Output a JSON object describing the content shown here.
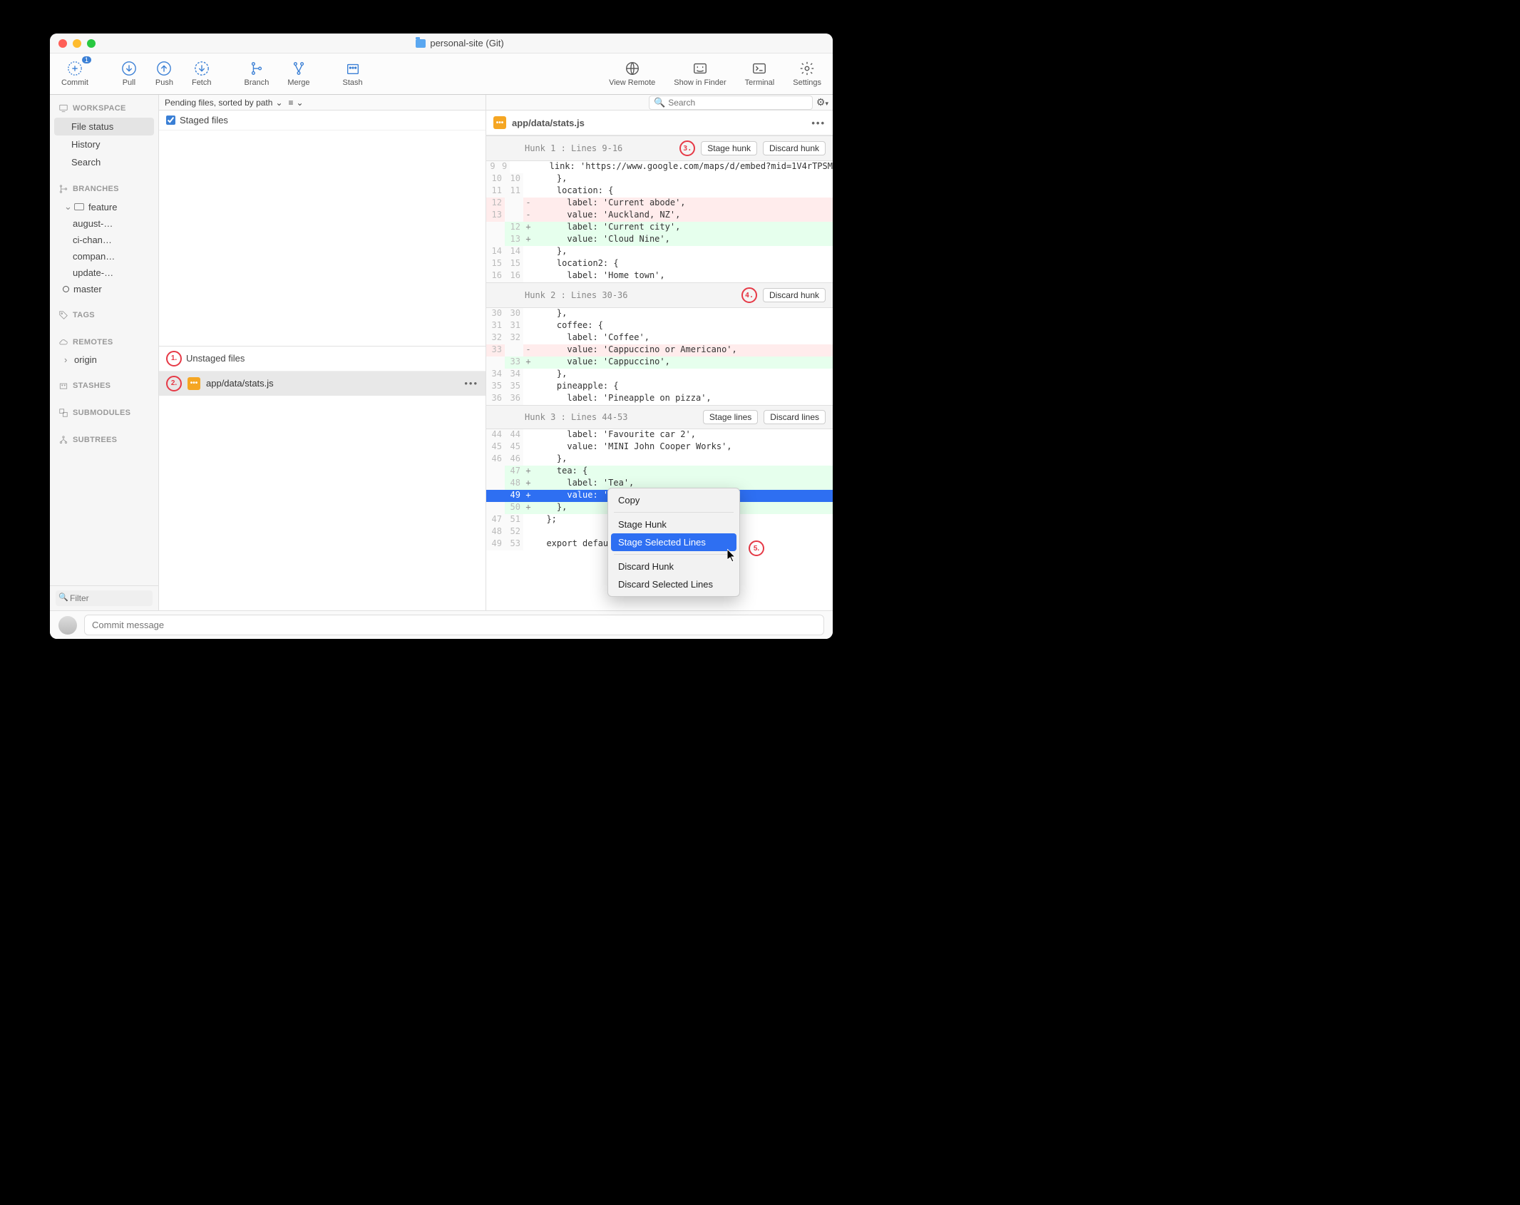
{
  "window": {
    "title": "personal-site (Git)"
  },
  "toolbar": {
    "commit": "Commit",
    "commit_badge": "1",
    "pull": "Pull",
    "push": "Push",
    "fetch": "Fetch",
    "branch": "Branch",
    "merge": "Merge",
    "stash": "Stash",
    "view_remote": "View Remote",
    "show_in_finder": "Show in Finder",
    "terminal": "Terminal",
    "settings": "Settings"
  },
  "sidebar": {
    "workspace": "WORKSPACE",
    "file_status": "File status",
    "history": "History",
    "search": "Search",
    "branches": "BRANCHES",
    "feature_folder": "feature",
    "branch_items": [
      "august-…",
      "ci-chan…",
      "compan…",
      "update-…"
    ],
    "master": "master",
    "tags": "TAGS",
    "remotes": "REMOTES",
    "origin": "origin",
    "stashes": "STASHES",
    "submodules": "SUBMODULES",
    "subtrees": "SUBTREES",
    "filter_placeholder": "Filter"
  },
  "middle": {
    "sort_label": "Pending files, sorted by path",
    "staged_label": "Staged files",
    "unstaged_label": "Unstaged files",
    "file_path": "app/data/stats.js",
    "search_placeholder": "Search"
  },
  "right": {
    "file_path": "app/data/stats.js",
    "hunk1": {
      "title": "Hunk 1 : Lines 9-16",
      "stage": "Stage hunk",
      "discard": "Discard hunk",
      "lines": [
        {
          "oldN": "9",
          "newN": "9",
          "mark": "",
          "text": "      link: 'https://www.google.com/maps/d/embed?mid=1V4rTPSM",
          "cls": ""
        },
        {
          "oldN": "10",
          "newN": "10",
          "mark": "",
          "text": "    },",
          "cls": ""
        },
        {
          "oldN": "11",
          "newN": "11",
          "mark": "",
          "text": "    location: {",
          "cls": ""
        },
        {
          "oldN": "12",
          "newN": "",
          "mark": "-",
          "text": "      label: 'Current abode',",
          "cls": "removed"
        },
        {
          "oldN": "13",
          "newN": "",
          "mark": "-",
          "text": "      value: 'Auckland, NZ',",
          "cls": "removed"
        },
        {
          "oldN": "",
          "newN": "12",
          "mark": "+",
          "text": "      label: 'Current city',",
          "cls": "added"
        },
        {
          "oldN": "",
          "newN": "13",
          "mark": "+",
          "text": "      value: 'Cloud Nine',",
          "cls": "added"
        },
        {
          "oldN": "14",
          "newN": "14",
          "mark": "",
          "text": "    },",
          "cls": ""
        },
        {
          "oldN": "15",
          "newN": "15",
          "mark": "",
          "text": "    location2: {",
          "cls": ""
        },
        {
          "oldN": "16",
          "newN": "16",
          "mark": "",
          "text": "      label: 'Home town',",
          "cls": ""
        }
      ]
    },
    "hunk2": {
      "title": "Hunk 2 : Lines 30-36",
      "discard": "Discard hunk",
      "lines": [
        {
          "oldN": "30",
          "newN": "30",
          "mark": "",
          "text": "    },",
          "cls": ""
        },
        {
          "oldN": "31",
          "newN": "31",
          "mark": "",
          "text": "    coffee: {",
          "cls": ""
        },
        {
          "oldN": "32",
          "newN": "32",
          "mark": "",
          "text": "      label: 'Coffee',",
          "cls": ""
        },
        {
          "oldN": "33",
          "newN": "",
          "mark": "-",
          "text": "      value: 'Cappuccino or Americano',",
          "cls": "removed"
        },
        {
          "oldN": "",
          "newN": "33",
          "mark": "+",
          "text": "      value: 'Cappuccino',",
          "cls": "added"
        },
        {
          "oldN": "34",
          "newN": "34",
          "mark": "",
          "text": "    },",
          "cls": ""
        },
        {
          "oldN": "35",
          "newN": "35",
          "mark": "",
          "text": "    pineapple: {",
          "cls": ""
        },
        {
          "oldN": "36",
          "newN": "36",
          "mark": "",
          "text": "      label: 'Pineapple on pizza',",
          "cls": ""
        }
      ]
    },
    "hunk3": {
      "title": "Hunk 3 : Lines 44-53",
      "stage": "Stage lines",
      "discard": "Discard lines",
      "lines": [
        {
          "oldN": "44",
          "newN": "44",
          "mark": "",
          "text": "      label: 'Favourite car 2',",
          "cls": ""
        },
        {
          "oldN": "45",
          "newN": "45",
          "mark": "",
          "text": "      value: 'MINI John Cooper Works',",
          "cls": ""
        },
        {
          "oldN": "46",
          "newN": "46",
          "mark": "",
          "text": "    },",
          "cls": ""
        },
        {
          "oldN": "",
          "newN": "47",
          "mark": "+",
          "text": "    tea: {",
          "cls": "added"
        },
        {
          "oldN": "",
          "newN": "48",
          "mark": "+",
          "text": "      label: 'Tea',",
          "cls": "added"
        },
        {
          "oldN": "",
          "newN": "49",
          "mark": "+",
          "text": "      value: 'Jasmine',",
          "cls": "added selected"
        },
        {
          "oldN": "",
          "newN": "50",
          "mark": "+",
          "text": "    },",
          "cls": "added"
        },
        {
          "oldN": "47",
          "newN": "51",
          "mark": "",
          "text": "  };",
          "cls": ""
        },
        {
          "oldN": "48",
          "newN": "52",
          "mark": "",
          "text": "",
          "cls": ""
        },
        {
          "oldN": "49",
          "newN": "53",
          "mark": "",
          "text": "  export default data;",
          "cls": ""
        }
      ]
    }
  },
  "commit": {
    "placeholder": "Commit message"
  },
  "context_menu": {
    "copy": "Copy",
    "stage_hunk": "Stage Hunk",
    "stage_selected": "Stage Selected Lines",
    "discard_hunk": "Discard Hunk",
    "discard_selected": "Discard Selected Lines"
  },
  "callouts": {
    "c1": "1.",
    "c2": "2.",
    "c3": "3.",
    "c4": "4.",
    "c5": "5."
  }
}
